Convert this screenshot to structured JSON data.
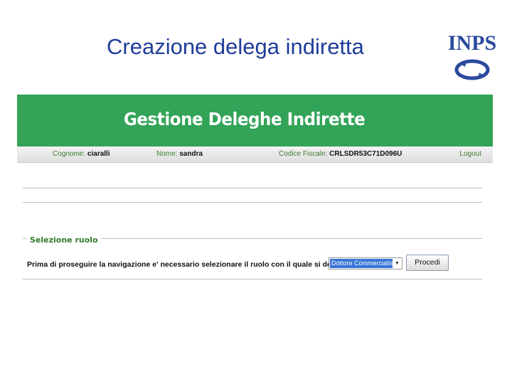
{
  "slide": {
    "title": "Creazione delega indiretta"
  },
  "logo": {
    "text": "INPS"
  },
  "app": {
    "title": "Gestione Deleghe Indirette",
    "user": {
      "cognome_label": "Cognome:",
      "cognome_value": "ciaralli",
      "nome_label": "Nome:",
      "nome_value": "sandra",
      "cf_label": "Codice Fiscale:",
      "cf_value": "CRLSDR53C71D096U",
      "logout": "Logout"
    },
    "role_section": {
      "legend": "Selezione ruolo",
      "prompt": "Prima di proseguire la navigazione e' necessario selezionare il ruolo con il quale si desidera operare:",
      "selected_role": "Dottore Commercialista",
      "proceed_button": "Procedi"
    }
  },
  "colors": {
    "header_green": "#32a357",
    "title_blue": "#1f3d99",
    "logo_blue": "#2b4a9e"
  }
}
